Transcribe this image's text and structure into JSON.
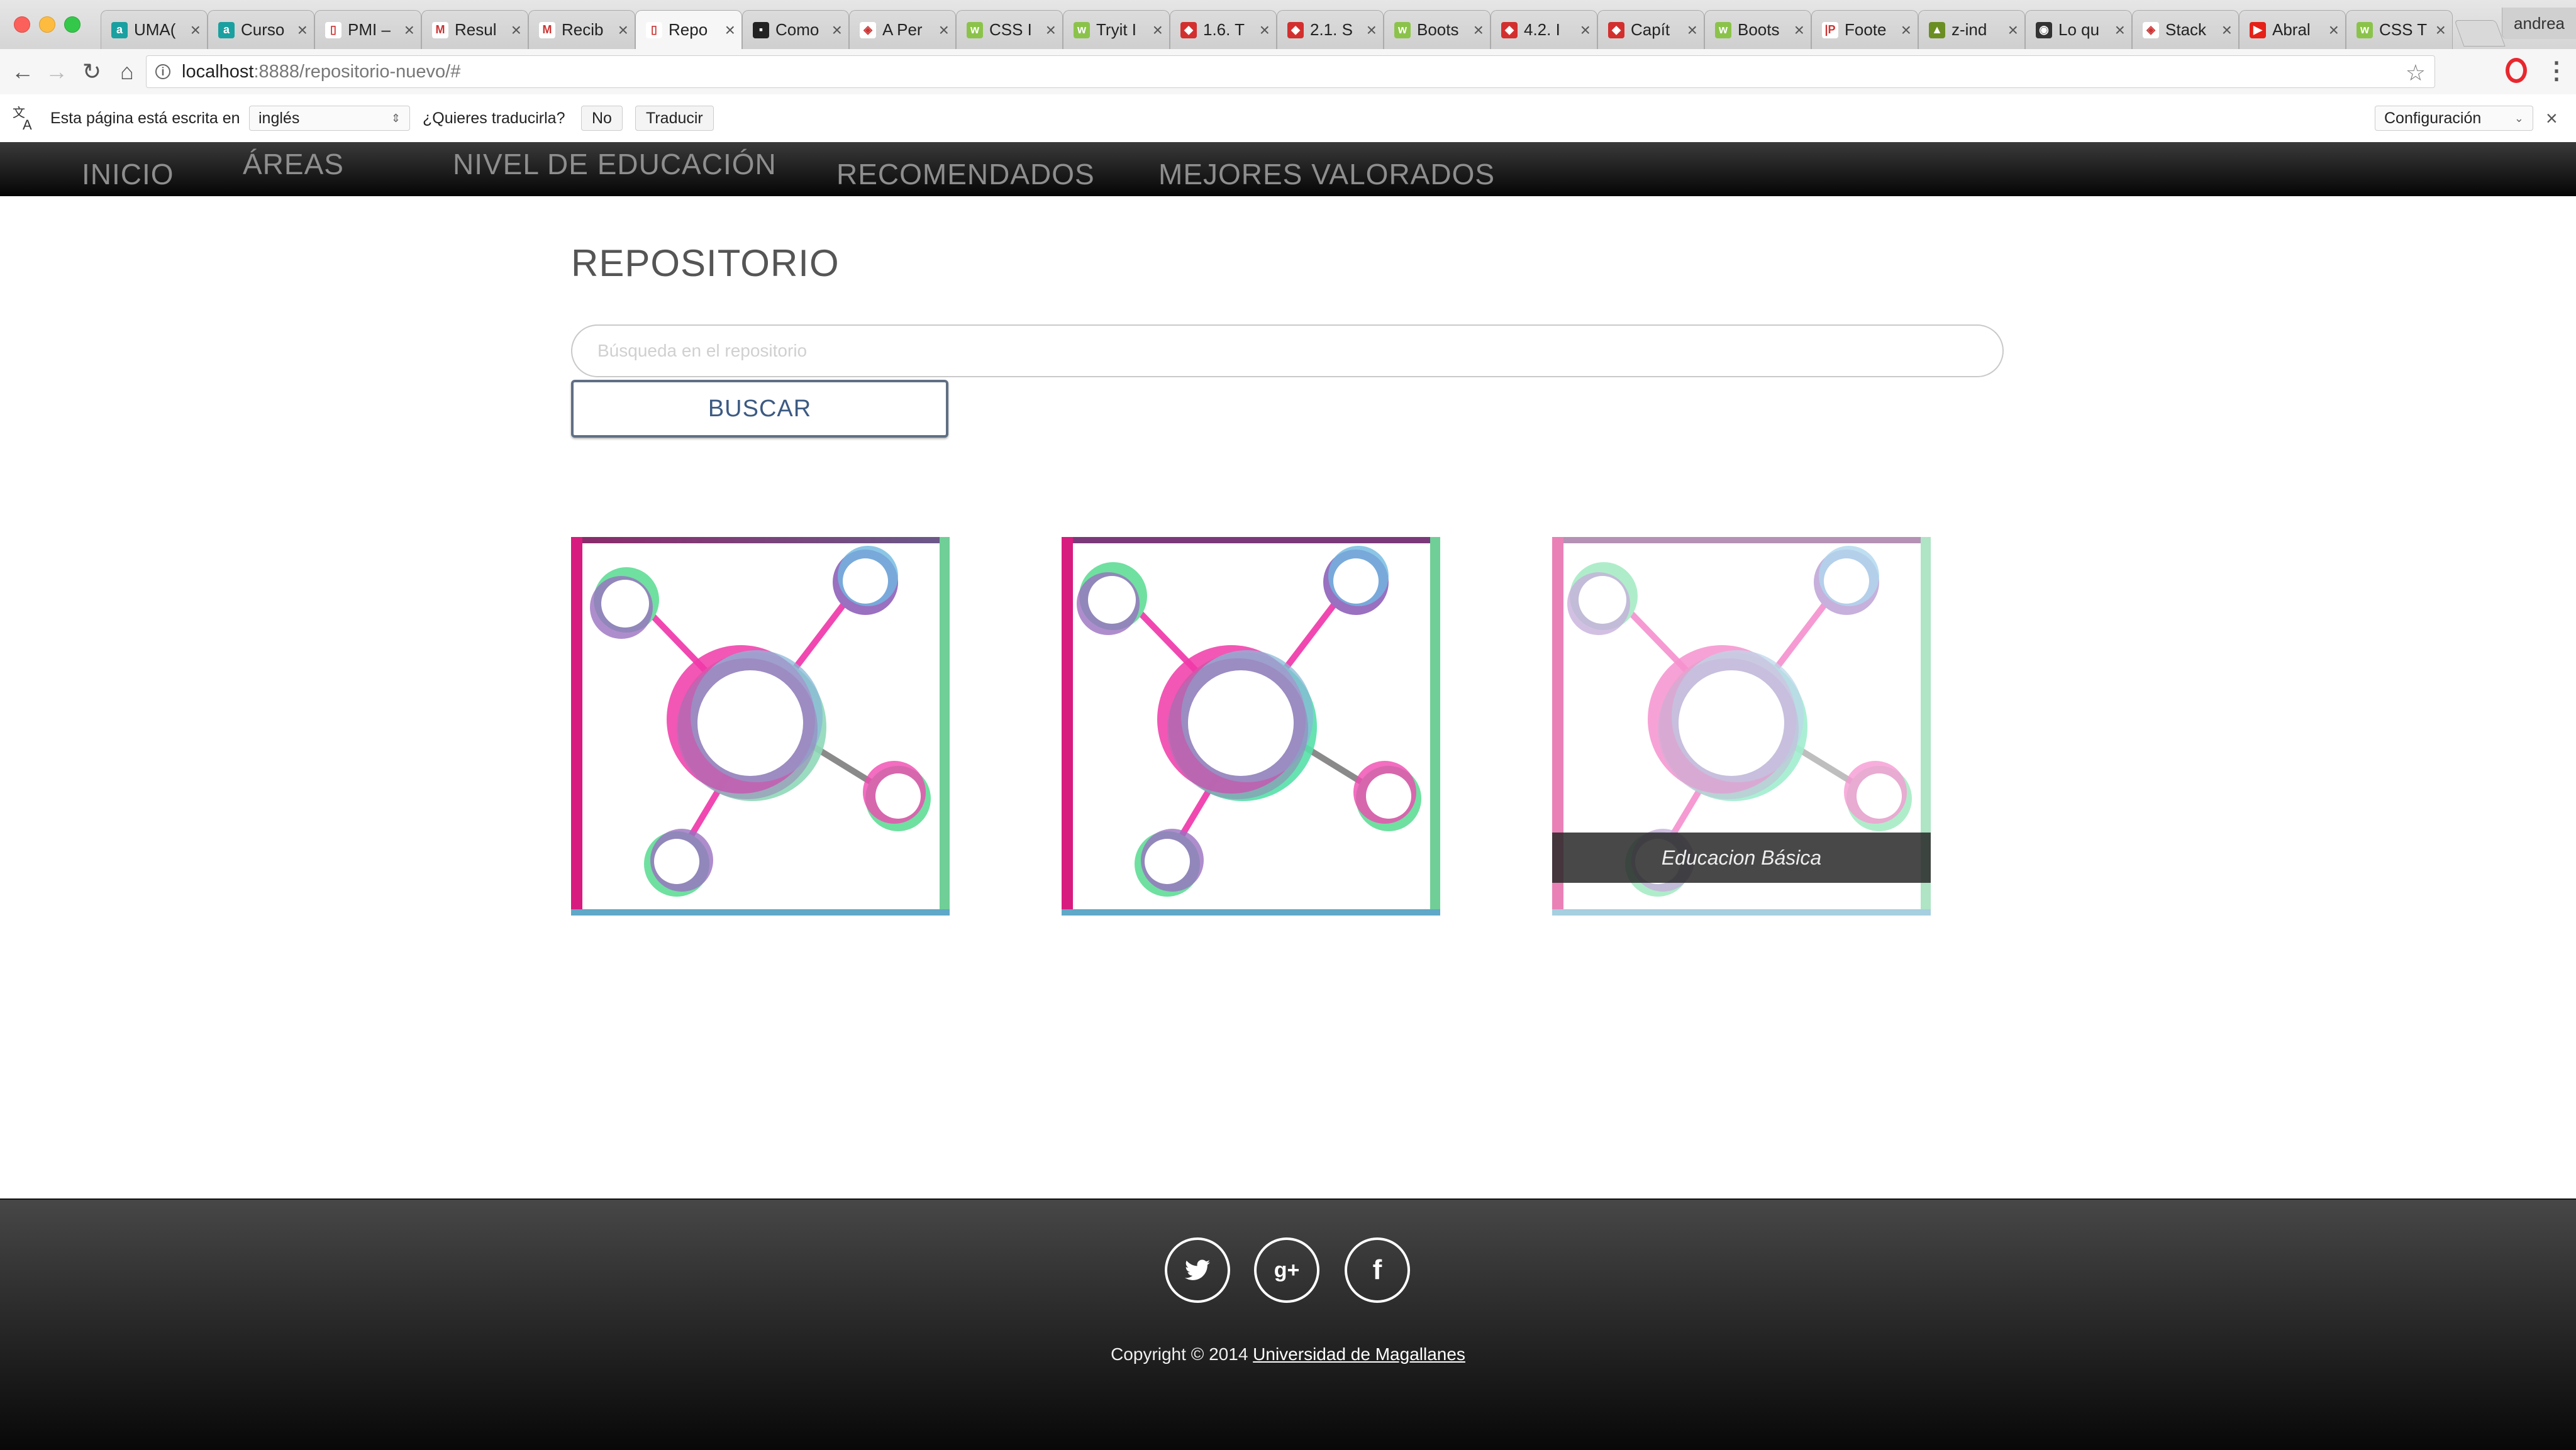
{
  "browser": {
    "tabs": [
      {
        "label": "UMA(",
        "favicon_color": "#1aa0a0",
        "favicon_glyph": "a"
      },
      {
        "label": "Curso",
        "favicon_color": "#1aa0a0",
        "favicon_glyph": "a"
      },
      {
        "label": "PMI –",
        "favicon_color": "#ffffff",
        "favicon_glyph": "▯"
      },
      {
        "label": "Resul",
        "favicon_color": "#ffffff",
        "favicon_glyph": "M"
      },
      {
        "label": "Recib",
        "favicon_color": "#ffffff",
        "favicon_glyph": "M"
      },
      {
        "label": "Repo",
        "favicon_color": "#ffffff",
        "favicon_glyph": "▯",
        "active": true
      },
      {
        "label": "Como",
        "favicon_color": "#222222",
        "favicon_glyph": "▪"
      },
      {
        "label": "A Per",
        "favicon_color": "#ffffff",
        "favicon_glyph": "◈"
      },
      {
        "label": "CSS I",
        "favicon_color": "#8bc34a",
        "favicon_glyph": "w"
      },
      {
        "label": "Tryit I",
        "favicon_color": "#8bc34a",
        "favicon_glyph": "w"
      },
      {
        "label": "1.6. T",
        "favicon_color": "#d32f2f",
        "favicon_glyph": "◆"
      },
      {
        "label": "2.1. S",
        "favicon_color": "#d32f2f",
        "favicon_glyph": "◆"
      },
      {
        "label": "Boots",
        "favicon_color": "#8bc34a",
        "favicon_glyph": "w"
      },
      {
        "label": "4.2. I",
        "favicon_color": "#d32f2f",
        "favicon_glyph": "◆"
      },
      {
        "label": "Capít",
        "favicon_color": "#d32f2f",
        "favicon_glyph": "◆"
      },
      {
        "label": "Boots",
        "favicon_color": "#8bc34a",
        "favicon_glyph": "w"
      },
      {
        "label": "Foote",
        "favicon_color": "#ffffff",
        "favicon_glyph": "|P"
      },
      {
        "label": "z-ind",
        "favicon_color": "#6b8e23",
        "favicon_glyph": "▲"
      },
      {
        "label": "Lo qu",
        "favicon_color": "#333333",
        "favicon_glyph": "◉"
      },
      {
        "label": "Stack",
        "favicon_color": "#ffffff",
        "favicon_glyph": "◈"
      },
      {
        "label": "Abral",
        "favicon_color": "#e62117",
        "favicon_glyph": "▶"
      },
      {
        "label": "CSS T",
        "favicon_color": "#8bc34a",
        "favicon_glyph": "w"
      }
    ],
    "profile_name": "andrea",
    "url_host": "localhost",
    "url_rest": ":8888/repositorio-nuevo/#",
    "icons": [
      "back-icon",
      "forward-icon",
      "reload-icon",
      "home-icon",
      "info-icon",
      "star-icon",
      "opera-icon",
      "menu-icon"
    ]
  },
  "translate_bar": {
    "prefix": "Esta página está escrita en",
    "language": "inglés",
    "question": "¿Quieres traducirla?",
    "no_label": "No",
    "translate_label": "Traducir",
    "settings_label": "Configuración",
    "close_glyph": "×"
  },
  "nav": {
    "items": [
      "INICIO",
      "ÁREAS",
      "NIVEL DE EDUCACIÓN",
      "RECOMENDADOS",
      "MEJORES VALORADOS"
    ]
  },
  "main": {
    "title": "REPOSITORIO",
    "search_placeholder": "Búsqueda en el repositorio",
    "search_button": "BUSCAR",
    "cards": [
      {
        "caption": ""
      },
      {
        "caption": ""
      },
      {
        "caption": "Educacion Básica",
        "hovered": true
      }
    ]
  },
  "footer": {
    "social": [
      {
        "name": "twitter",
        "glyph": "🐦"
      },
      {
        "name": "google-plus",
        "glyph": "g+"
      },
      {
        "name": "facebook",
        "glyph": "f"
      }
    ],
    "copyright_prefix": "Copyright © 2014",
    "copyright_link": "Universidad de Magallanes"
  },
  "colors": {
    "nav_text": "#8e8e8e",
    "button_text": "#3c5a82",
    "pink": "#e6007e",
    "green": "#6cdb9c",
    "blue": "#6ab0d8"
  }
}
